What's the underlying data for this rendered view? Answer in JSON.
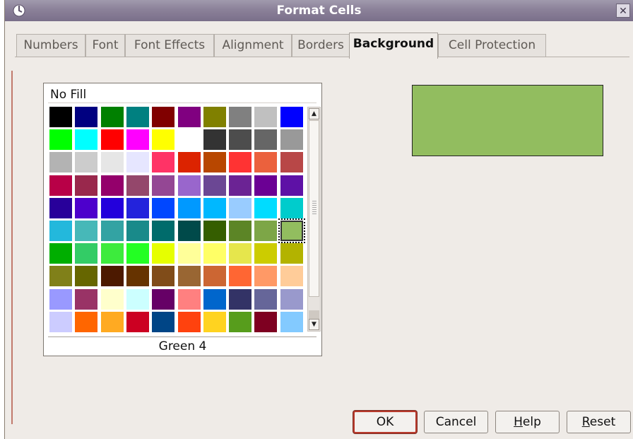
{
  "window": {
    "title": "Format Cells",
    "close_label": "✕"
  },
  "tabs": [
    {
      "label": "Numbers",
      "active": false
    },
    {
      "label": "Font",
      "active": false
    },
    {
      "label": "Font Effects",
      "active": false
    },
    {
      "label": "Alignment",
      "active": false
    },
    {
      "label": "Borders",
      "active": false
    },
    {
      "label": "Background",
      "active": true
    },
    {
      "label": "Cell Protection",
      "active": false
    }
  ],
  "palette": {
    "no_fill_label": "No Fill",
    "selected_color_name": "Green 4",
    "selected_color": "#92bd5f",
    "selected_index": 59,
    "colors": [
      "#000000",
      "#000080",
      "#008000",
      "#008080",
      "#800000",
      "#800080",
      "#808000",
      "#808080",
      "#c0c0c0",
      "#0000ff",
      "#00ff00",
      "#00ffff",
      "#ff0000",
      "#ff00ff",
      "#ffff00",
      "#ffffff",
      "#333333",
      "#4d4d4d",
      "#666666",
      "#999999",
      "#b3b3b3",
      "#cccccc",
      "#e6e6e6",
      "#e6e6ff",
      "#ff3366",
      "#dc2300",
      "#b84700",
      "#ff3333",
      "#eb613d",
      "#b84747",
      "#b80047",
      "#99284c",
      "#94006b",
      "#94476b",
      "#944794",
      "#9966cc",
      "#6b4794",
      "#6b2394",
      "#6b0094",
      "#5e11a6",
      "#28009a",
      "#4d00cc",
      "#2300dc",
      "#2323dc",
      "#0047ff",
      "#0099ff",
      "#00b8ff",
      "#99ccff",
      "#00dcff",
      "#00cccc",
      "#23b8dc",
      "#47b8b8",
      "#33a3a3",
      "#198a8a",
      "#006b6b",
      "#004a4a",
      "#355e00",
      "#5c8526",
      "#7da647",
      "#92bd5f",
      "#00ae00",
      "#33cc66",
      "#3deb3d",
      "#23ff23",
      "#e6ff00",
      "#ffff99",
      "#ffff66",
      "#e6e64c",
      "#cccc00",
      "#b3b300",
      "#808019",
      "#666600",
      "#4c1900",
      "#663300",
      "#804c19",
      "#996633",
      "#cc6633",
      "#ff6633",
      "#ff9966",
      "#ffcc99",
      "#9999ff",
      "#993366",
      "#ffffcc",
      "#ccffff",
      "#660066",
      "#ff8080",
      "#0066cc",
      "#333366",
      "#666699",
      "#9999cc",
      "#ccccff",
      "#ff6600",
      "#ffaa22",
      "#cc0022",
      "#004586",
      "#ff420e",
      "#ffd320",
      "#579d1c",
      "#7e0021",
      "#83caff"
    ],
    "scroll_up_label": "▲",
    "scroll_down_label": "▼"
  },
  "preview": {
    "color": "#92bd5f"
  },
  "buttons": {
    "ok": "OK",
    "cancel": "Cancel",
    "help_mnemonic": "H",
    "help_rest": "elp",
    "reset_mnemonic": "R",
    "reset_rest": "eset"
  }
}
